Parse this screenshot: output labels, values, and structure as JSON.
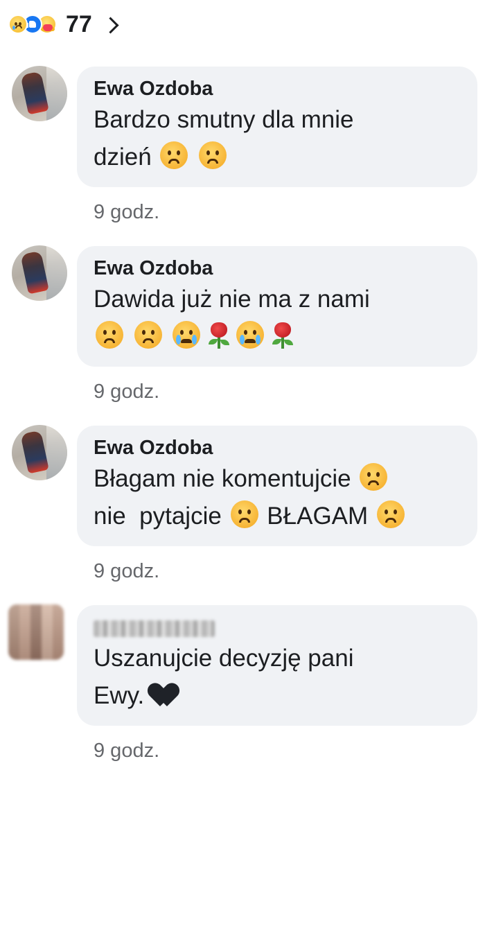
{
  "reactions": {
    "icons": [
      "sad-reaction-icon",
      "like-reaction-icon",
      "care-reaction-icon"
    ],
    "count": "77"
  },
  "comments": [
    {
      "author": "Ewa Ozdoba",
      "line1": "Bardzo smutny dla mnie",
      "line2": "dzień",
      "line2_emojis": [
        "frowning-emoji",
        "frowning-emoji"
      ],
      "time": "9 godz."
    },
    {
      "author": "Ewa Ozdoba",
      "line1": "Dawida już nie ma z nami",
      "line2_emojis": [
        "frowning-emoji",
        "frowning-emoji",
        "crying-emoji",
        "rose-emoji",
        "crying-emoji",
        "rose-emoji"
      ],
      "time": "9 godz."
    },
    {
      "author": "Ewa Ozdoba",
      "line1": "Błagam nie komentujcie",
      "line1_emojis": [
        "frowning-emoji"
      ],
      "line2a": "nie  pytajcie",
      "line2b": "BŁAGAM",
      "line2_emojis": [
        "frowning-emoji",
        "frowning-emoji"
      ],
      "time": "9 godz."
    },
    {
      "author": "",
      "author_blurred": true,
      "line1": "Uszanujcie decyzję pani",
      "line2": "Ewy.",
      "line2_emojis": [
        "black-heart-emoji"
      ],
      "time": "9 godz."
    }
  ],
  "colors": {
    "bubble": "#f0f2f5",
    "text": "#1c1e21",
    "muted": "#65676b",
    "like_blue": "#1877f2"
  }
}
